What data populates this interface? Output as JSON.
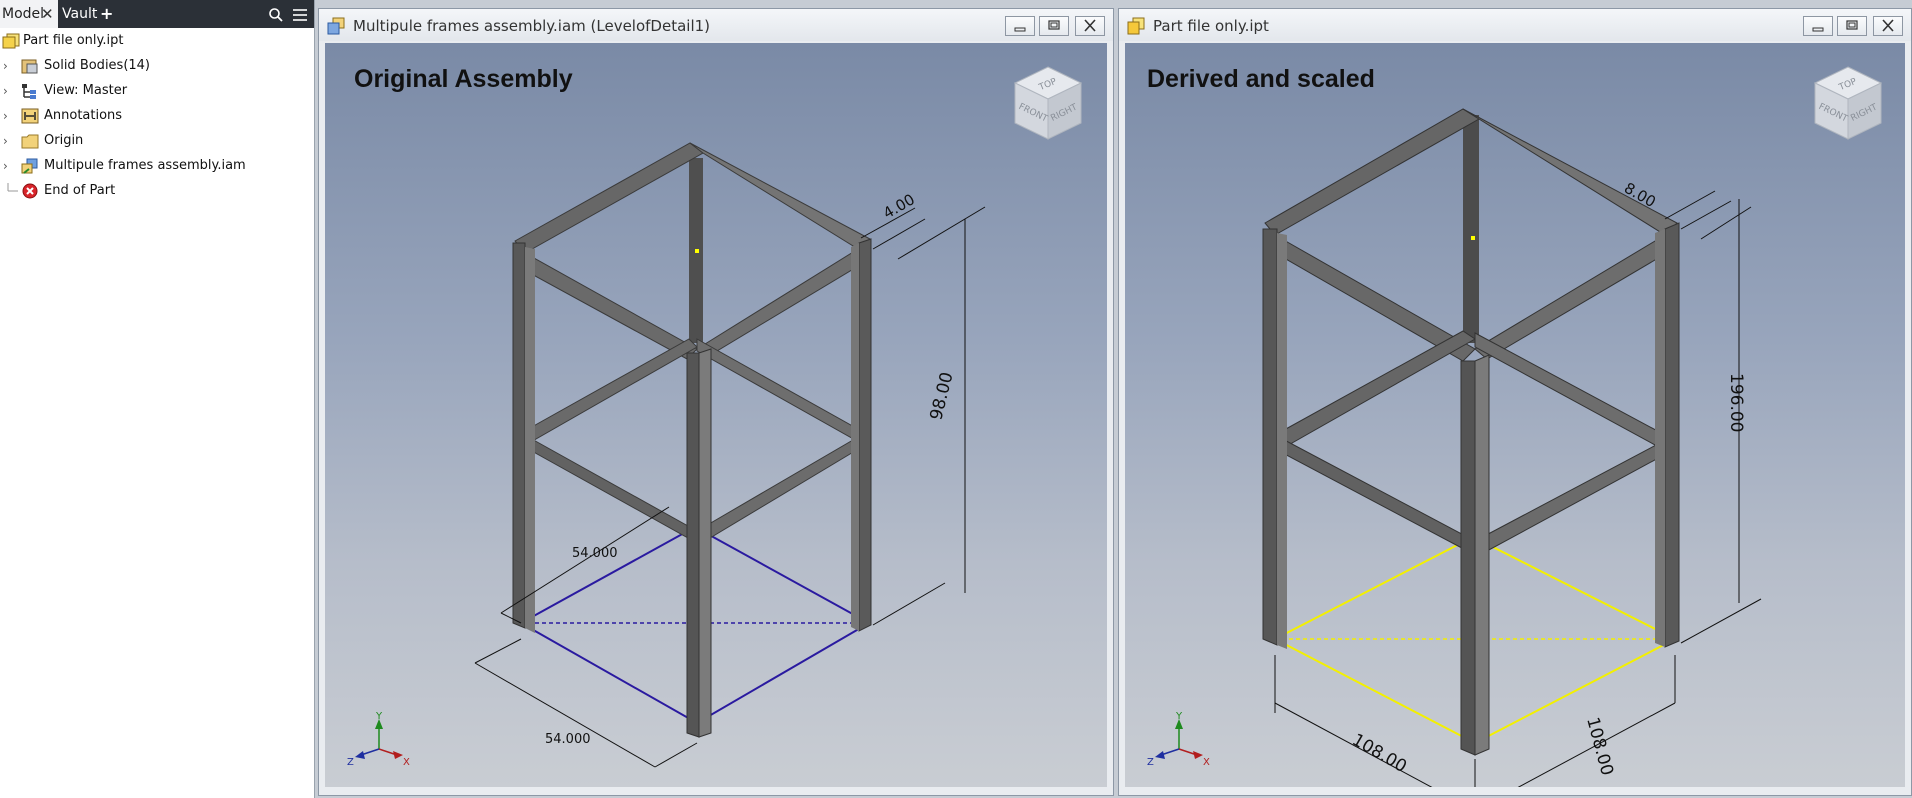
{
  "browser": {
    "tabs": {
      "model": "Model",
      "vault": "Vault",
      "add": "+"
    },
    "items": [
      {
        "label": "Part file only.ipt",
        "icon": "part-file-icon"
      },
      {
        "label": "Solid Bodies(14)",
        "icon": "solid-bodies-icon"
      },
      {
        "label": "View: Master",
        "icon": "view-icon"
      },
      {
        "label": "Annotations",
        "icon": "annotations-icon"
      },
      {
        "label": "Origin",
        "icon": "origin-folder-icon"
      },
      {
        "label": "Multipule frames assembly.iam",
        "icon": "derived-assembly-icon"
      },
      {
        "label": "End of Part",
        "icon": "end-of-part-icon"
      }
    ]
  },
  "windows": {
    "left": {
      "title": "Multipule frames assembly.iam (LevelofDetail1)",
      "heading": "Original Assembly",
      "dims": {
        "thickness": "4.00",
        "height": "98.00",
        "depth": "54.000",
        "width": "54.000"
      },
      "sketch_color": "#2a1aa0"
    },
    "right": {
      "title": "Part file only.ipt",
      "heading": "Derived and scaled",
      "dims": {
        "thickness": "8.00",
        "height": "196.00",
        "depth": "108.00",
        "width": "108.00"
      },
      "sketch_color": "#f3f000"
    }
  },
  "viewcube": {
    "top": "TOP",
    "front": "FRONT",
    "right": "RIGHT"
  },
  "triad": {
    "x": "X",
    "y": "Y",
    "z": "Z"
  },
  "colors": {
    "frame": "#5a5a5a",
    "background_top": "#7a8aa6",
    "background_bottom": "#c9cdd3"
  }
}
